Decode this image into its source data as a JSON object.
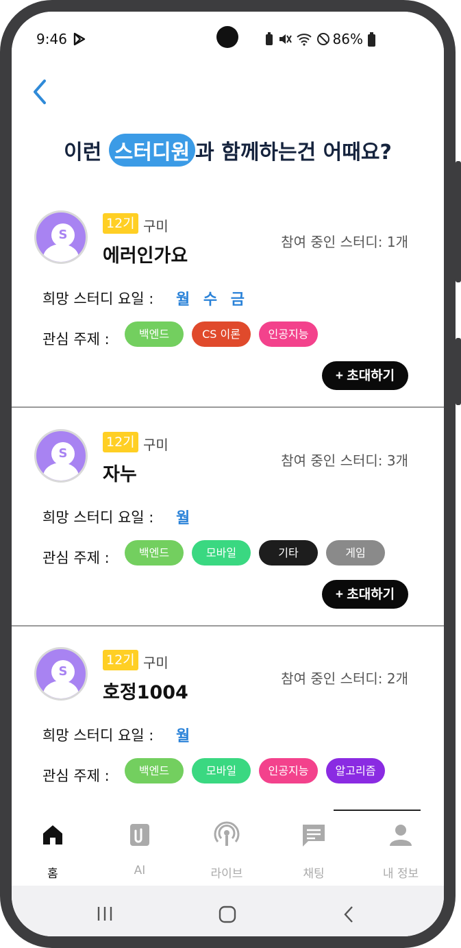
{
  "status": {
    "time": "9:46",
    "battery": "86%"
  },
  "header": {
    "title_pre": "이런 ",
    "title_highlight": "스터디원",
    "title_post": "과 함께하는건 어때요?"
  },
  "labels": {
    "count_prefix": "참여 중인 스터디: ",
    "days_label": "희망 스터디 요일 :",
    "topics_label": "관심 주제 :",
    "invite": "+ 초대하기",
    "avatar_letter": "S"
  },
  "members": [
    {
      "generation": "12기",
      "campus": "구미",
      "nickname": "에러인가요",
      "study_count": "1개",
      "days": "월 수 금",
      "tags": [
        {
          "label": "백엔드",
          "color": "#73cf5f"
        },
        {
          "label": "CS 이론",
          "color": "#e04a2c"
        },
        {
          "label": "인공지능",
          "color": "#f3428c"
        }
      ]
    },
    {
      "generation": "12기",
      "campus": "구미",
      "nickname": "자누",
      "study_count": "3개",
      "days": "월",
      "tags": [
        {
          "label": "백엔드",
          "color": "#73cf5f"
        },
        {
          "label": "모바일",
          "color": "#3ad881"
        },
        {
          "label": "기타",
          "color": "#1d1d1d"
        },
        {
          "label": "게임",
          "color": "#8a8a8a"
        }
      ]
    },
    {
      "generation": "12기",
      "campus": "구미",
      "nickname": "호정1004",
      "study_count": "2개",
      "days": "월",
      "tags": [
        {
          "label": "백엔드",
          "color": "#73cf5f"
        },
        {
          "label": "모바일",
          "color": "#3ad881"
        },
        {
          "label": "인공지능",
          "color": "#f3428c"
        },
        {
          "label": "알고리즘",
          "color": "#8a2be2"
        }
      ]
    }
  ],
  "nav": {
    "items": [
      {
        "label": "홈",
        "icon": "home-icon",
        "active": true
      },
      {
        "label": "AI",
        "icon": "clip-icon",
        "active": false
      },
      {
        "label": "라이브",
        "icon": "broadcast-icon",
        "active": false
      },
      {
        "label": "채팅",
        "icon": "chat-icon",
        "active": false
      },
      {
        "label": "내 정보",
        "icon": "profile-icon",
        "active": false
      }
    ]
  }
}
